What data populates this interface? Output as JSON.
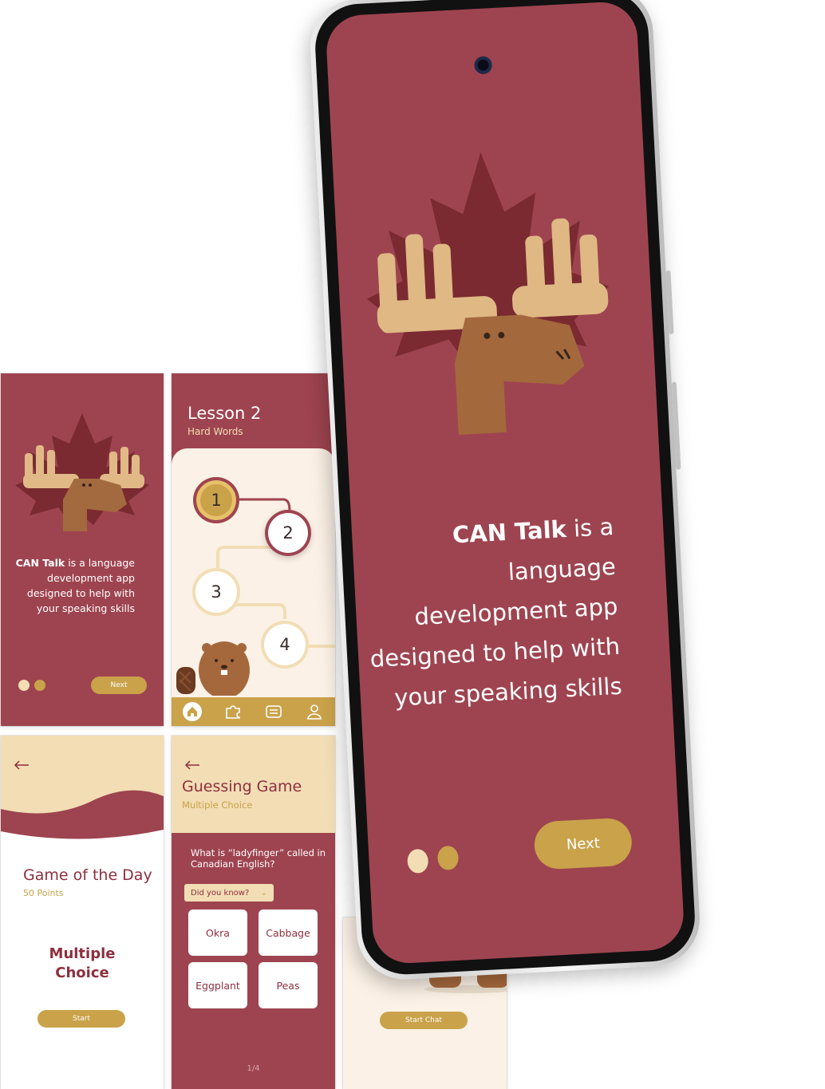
{
  "intro": {
    "brand": "CAN Talk",
    "text_rest": " is a language development app designed to help with your speaking skills",
    "next_label": "Next",
    "lines": [
      "is a language",
      "development app",
      "designed to help with",
      "your speaking skills"
    ]
  },
  "lesson": {
    "title": "Lesson 2",
    "subtitle": "Hard Words",
    "nodes": [
      "1",
      "2",
      "3",
      "4"
    ],
    "tabs": [
      "home-icon",
      "puzzle-icon",
      "list-icon",
      "profile-icon"
    ]
  },
  "game_of_day": {
    "title": "Game of the Day",
    "points": "50 Points",
    "type_line1": "Multiple",
    "type_line2": "Choice",
    "start_label": "Start"
  },
  "guessing": {
    "title": "Guessing Game",
    "subtitle": "Multiple Choice",
    "question": "What is “ladyfinger” called in Canadian English?",
    "hint_label": "Did you know?",
    "choices": [
      "Okra",
      "Cabbage",
      "Eggplant",
      "Peas"
    ],
    "page": "1/4"
  },
  "chat": {
    "start_label": "Start Chat"
  },
  "colors": {
    "maroon": "#9e4450",
    "dark_maroon": "#7a2a30",
    "gold": "#c9a24a",
    "cream": "#fbf1e6",
    "sand": "#f2ddb4"
  }
}
